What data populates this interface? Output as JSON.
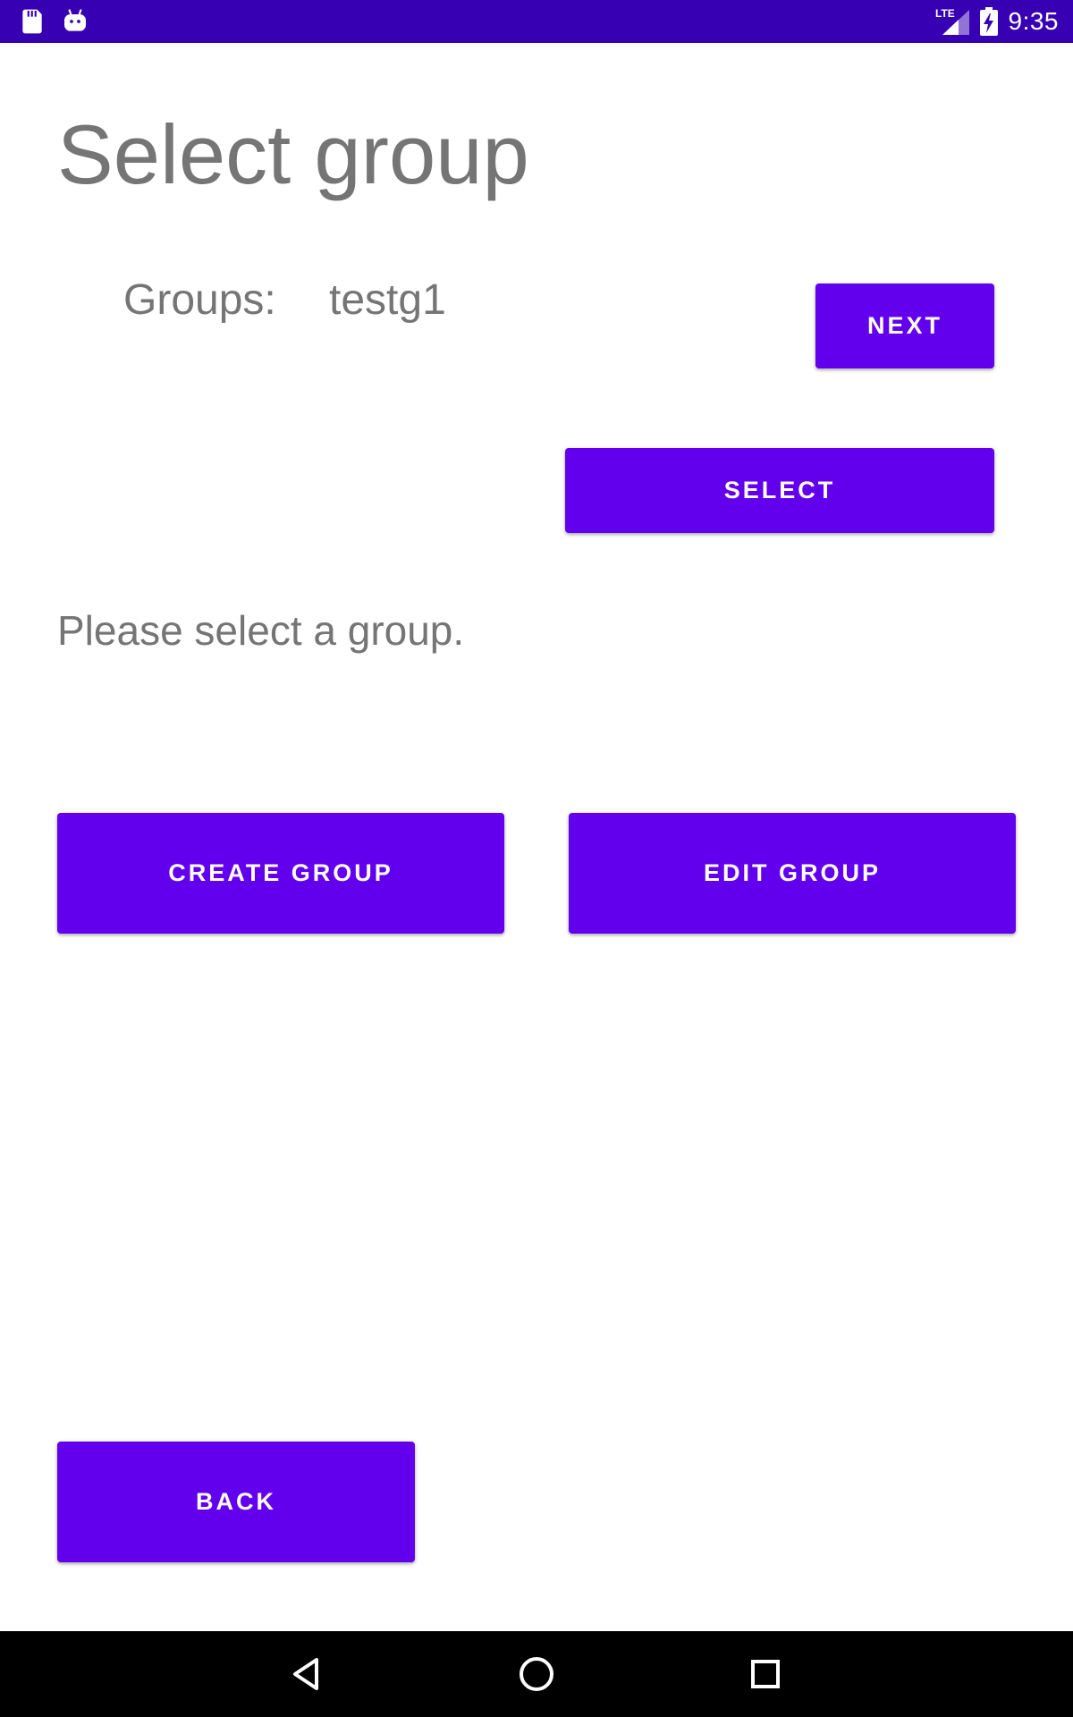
{
  "status_bar": {
    "time": "9:35",
    "network_label": "LTE",
    "background_color": "#3700B3",
    "icons_left": [
      "sd-card-icon",
      "android-icon"
    ],
    "icons_right": [
      "signal-icon",
      "battery-charging-icon"
    ]
  },
  "page": {
    "title": "Select group",
    "groups_label": "Groups:",
    "groups_value": "testg1",
    "info_text": "Please select a group."
  },
  "buttons": {
    "next": "NEXT",
    "select": "SELECT",
    "create_group": "CREATE GROUP",
    "edit_group": "EDIT GROUP",
    "back": "BACK"
  },
  "nav_bar": {
    "icons": [
      "back-icon",
      "home-icon",
      "recents-icon"
    ]
  },
  "colors": {
    "primary": "#6200EE",
    "primary_dark": "#3700B3",
    "text_secondary": "#757575"
  }
}
